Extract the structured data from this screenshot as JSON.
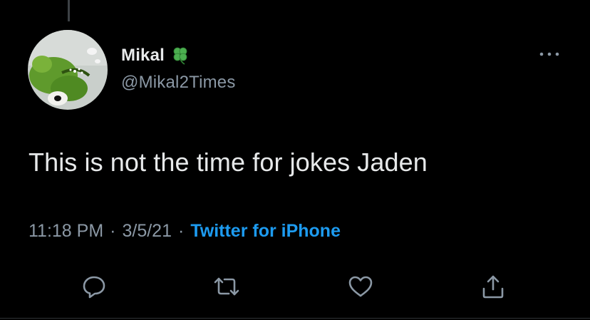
{
  "colors": {
    "background": "#000000",
    "primary_text": "#e7e9ea",
    "secondary_text": "#8b98a5",
    "accent": "#1d9bf0",
    "icon": "#8b98a5",
    "clover": "#4caf50"
  },
  "author": {
    "display_name": "Mikal",
    "handle": "@Mikal2Times",
    "name_emoji_icon": "four-leaf-clover-icon",
    "avatar_icon": "green-frog-puppet-avatar"
  },
  "tweet": {
    "text": "This is not the time for jokes Jaden",
    "time": "11:18 PM",
    "date": "3/5/21",
    "separator": "·",
    "source": "Twitter for iPhone"
  },
  "actions": [
    {
      "name": "reply",
      "icon": "reply-icon"
    },
    {
      "name": "retweet",
      "icon": "retweet-icon"
    },
    {
      "name": "like",
      "icon": "heart-icon"
    },
    {
      "name": "share",
      "icon": "share-icon"
    }
  ],
  "more_menu_icon": "more-dots-icon"
}
